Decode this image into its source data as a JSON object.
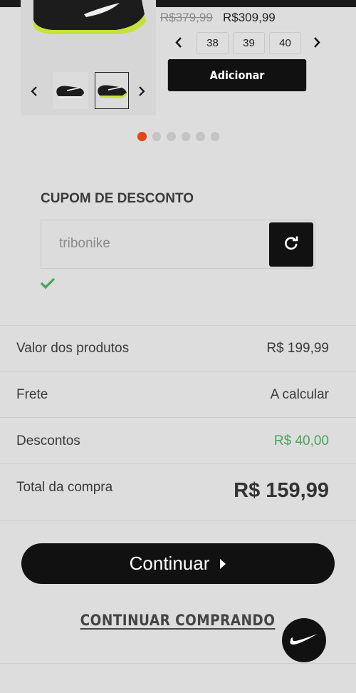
{
  "product": {
    "old_price": "R$379,99",
    "new_price": "R$309,99",
    "sizes": [
      "38",
      "39",
      "40"
    ],
    "add_label": "Adicionar",
    "carousel_dots": 6,
    "active_dot": 0
  },
  "coupon": {
    "title": "CUPOM DE DESCONTO",
    "value": "tribonike",
    "apply_icon": "refresh-icon",
    "status_icon": "check-icon"
  },
  "summary": {
    "rows": [
      {
        "label": "Valor dos produtos",
        "value": "R$ 199,99"
      },
      {
        "label": "Frete",
        "value": "A calcular"
      },
      {
        "label": "Descontos",
        "value": "R$ 40,00"
      },
      {
        "label": "Total da compra",
        "value": "R$ 159,99"
      }
    ]
  },
  "actions": {
    "continue_label": "Continuar",
    "keep_shopping_label": "CONTINUAR COMPRANDO"
  },
  "colors": {
    "accent_dot": "#de4a12",
    "discount_green": "#49a35a",
    "primary_black": "#111111"
  }
}
